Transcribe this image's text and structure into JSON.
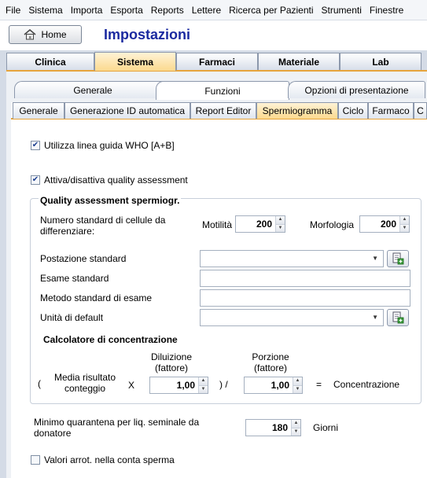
{
  "menu": [
    "File",
    "Sistema",
    "Importa",
    "Esporta",
    "Reports",
    "Lettere",
    "Ricerca per Pazienti",
    "Strumenti",
    "Finestre"
  ],
  "toolbar": {
    "home_label": "Home",
    "title": "Impostazioni"
  },
  "main_tabs": [
    {
      "label": "Clinica",
      "active": false
    },
    {
      "label": "Sistema",
      "active": true
    },
    {
      "label": "Farmaci",
      "active": false
    },
    {
      "label": "Materiale",
      "active": false
    },
    {
      "label": "Lab",
      "active": false
    }
  ],
  "sub_tabs": [
    {
      "label": "Generale",
      "active": false
    },
    {
      "label": "Funzioni",
      "active": true
    },
    {
      "label": "Opzioni di presentazione",
      "active": false
    }
  ],
  "func_tabs": [
    {
      "label": "Generale",
      "active": false
    },
    {
      "label": "Generazione ID automatica",
      "active": false
    },
    {
      "label": "Report Editor",
      "active": false
    },
    {
      "label": "Spermiogramma",
      "active": true
    },
    {
      "label": "Ciclo",
      "active": false
    },
    {
      "label": "Farmaco",
      "active": false
    },
    {
      "label": "C",
      "active": false
    }
  ],
  "settings": {
    "who_label": "Utilizza linea guida WHO [A+B]",
    "who_checked": true,
    "qa_label": "Attiva/disattiva quality assessment",
    "qa_checked": true,
    "group_title": "Quality assessment spermiogr.",
    "cells_label": "Numero standard di cellule da differenziare:",
    "motility_label": "Motilità",
    "motility_value": "200",
    "morphology_label": "Morfologia",
    "morphology_value": "200",
    "workstation_label": "Postazione standard",
    "workstation_value": "",
    "exam_label": "Esame standard",
    "exam_value": "",
    "method_label": "Metodo standard di esame",
    "method_value": "",
    "unit_label": "Unità di default",
    "unit_value": "",
    "calc_title": "Calcolatore di concentrazione",
    "calc_paren_open": "(",
    "calc_mean_label": "Media risultato conteggio",
    "calc_x": "X",
    "dilution_label": "Diluizione (fattore)",
    "dilution_value": "1,00",
    "calc_divide": ") /",
    "portion_label": "Porzione (fattore)",
    "portion_value": "1,00",
    "calc_equals": "=",
    "concentration_label": "Concentrazione",
    "quarantine_label": "Minimo quarantena per liq. seminale da donatore",
    "quarantine_value": "180",
    "quarantine_unit": "Giorni",
    "rounded_label": "Valori arrot. nella conta sperma",
    "rounded_checked": false
  }
}
